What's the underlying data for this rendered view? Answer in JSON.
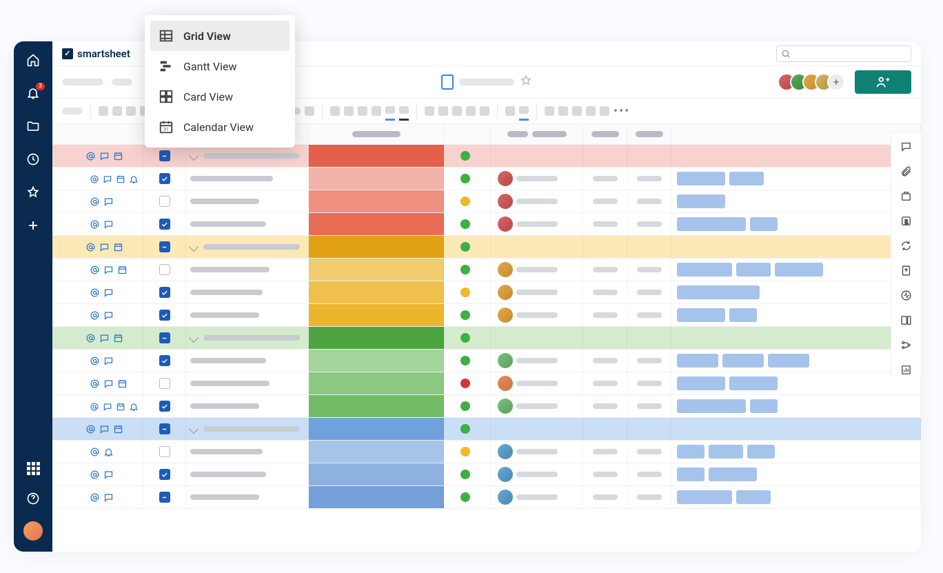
{
  "app": {
    "name": "smartsheet"
  },
  "nav": {
    "notifications_badge": "3"
  },
  "view_menu": {
    "items": [
      {
        "label": "Grid View",
        "selected": true
      },
      {
        "label": "Gantt View",
        "selected": false
      },
      {
        "label": "Card View",
        "selected": false
      },
      {
        "label": "Calendar View",
        "selected": false
      }
    ]
  },
  "rows": [
    {
      "type": "parent",
      "bg": "#f8d2cf",
      "color": "#e3614a",
      "icons": [
        "at",
        "chat",
        "cal"
      ],
      "chk": "indet",
      "status": "green",
      "nameW": 140
    },
    {
      "type": "child",
      "bg": "#fff",
      "color": "#f2b3aa",
      "icons": [
        "at",
        "chat",
        "cal",
        "bell"
      ],
      "chk": "checked",
      "status": "green",
      "av": "avc1",
      "nameW": 120,
      "tags": [
        70,
        50
      ]
    },
    {
      "type": "child",
      "bg": "#fff",
      "color": "#ef8f80",
      "icons": [
        "at",
        "chat"
      ],
      "chk": "empty",
      "status": "yellow",
      "av": "avc1",
      "nameW": 100,
      "tags": [
        70
      ]
    },
    {
      "type": "child",
      "bg": "#fff",
      "color": "#e96c56",
      "icons": [
        "at",
        "chat"
      ],
      "chk": "checked",
      "status": "green",
      "av": "avc1",
      "nameW": 110,
      "tags": [
        100,
        40
      ]
    },
    {
      "type": "parent",
      "bg": "#fce9b6",
      "color": "#e1a117",
      "icons": [
        "at",
        "chat",
        "cal"
      ],
      "chk": "indet",
      "status": "green",
      "nameW": 140
    },
    {
      "type": "child",
      "bg": "#fff",
      "color": "#f2cb6f",
      "icons": [
        "at",
        "chat",
        "cal"
      ],
      "chk": "empty",
      "status": "green",
      "av": "avc3",
      "nameW": 115,
      "tags": [
        80,
        50,
        70
      ]
    },
    {
      "type": "child",
      "bg": "#fff",
      "color": "#efc04c",
      "icons": [
        "at",
        "chat"
      ],
      "chk": "checked",
      "status": "yellow",
      "av": "avc3",
      "nameW": 105,
      "tags": [
        120
      ]
    },
    {
      "type": "child",
      "bg": "#fff",
      "color": "#ecb62c",
      "icons": [
        "at",
        "chat"
      ],
      "chk": "checked",
      "status": "green",
      "av": "avc3",
      "nameW": 100,
      "tags": [
        70,
        40
      ]
    },
    {
      "type": "parent",
      "bg": "#d5ebce",
      "color": "#4ca33f",
      "icons": [
        "at",
        "chat",
        "cal"
      ],
      "chk": "indet",
      "status": "green",
      "nameW": 140
    },
    {
      "type": "child",
      "bg": "#fff",
      "color": "#a3d49a",
      "icons": [
        "at",
        "chat"
      ],
      "chk": "checked",
      "status": "green",
      "av": "avc6",
      "nameW": 110,
      "tags": [
        60,
        60,
        60
      ]
    },
    {
      "type": "child",
      "bg": "#fff",
      "color": "#8bc880",
      "icons": [
        "at",
        "chat",
        "cal"
      ],
      "chk": "empty",
      "status": "red",
      "av": "avc4",
      "nameW": 115,
      "tags": [
        70,
        70
      ]
    },
    {
      "type": "child",
      "bg": "#fff",
      "color": "#73bc66",
      "icons": [
        "at",
        "chat",
        "cal",
        "bell"
      ],
      "chk": "checked",
      "status": "green",
      "av": "avc6",
      "nameW": 100,
      "tags": [
        100,
        40
      ]
    },
    {
      "type": "parent",
      "bg": "#cadef6",
      "color": "#6fa2dd",
      "icons": [
        "at",
        "chat",
        "cal"
      ],
      "chk": "indet",
      "status": "green",
      "nameW": 140
    },
    {
      "type": "child",
      "bg": "#fff",
      "color": "#a6c3e8",
      "icons": [
        "at",
        "bell"
      ],
      "chk": "empty",
      "status": "yellow",
      "av": "avc5",
      "nameW": 105,
      "tags": [
        40,
        50,
        40
      ]
    },
    {
      "type": "child",
      "bg": "#fff",
      "color": "#8db1e0",
      "icons": [
        "at",
        "chat"
      ],
      "chk": "checked",
      "status": "green",
      "av": "avc5",
      "nameW": 110,
      "tags": [
        40,
        70
      ]
    },
    {
      "type": "child",
      "bg": "#fff",
      "color": "#749fd8",
      "icons": [
        "at",
        "chat"
      ],
      "chk": "indet",
      "status": "green",
      "av": "avc5",
      "nameW": 100,
      "tags": [
        80,
        50
      ]
    }
  ]
}
